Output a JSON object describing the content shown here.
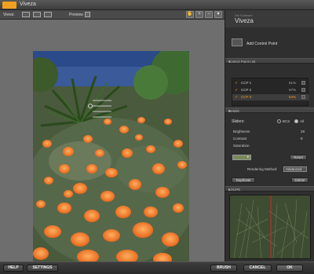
{
  "window": {
    "title": "Viveza"
  },
  "toolbar": {
    "views_label": "Views:",
    "preview_label": "Preview"
  },
  "photo": {
    "filename": "1080243.RAW",
    "info": "(7.8MP, 3072 x 2304, 300 DPI, RGB, 8 bit)"
  },
  "panel": {
    "brand_small": "Nik Software",
    "brand": "Viveza",
    "add_control_point": "Add Control Point",
    "control_point_list_header": "Control Point List",
    "control_points": [
      {
        "name": "CCP 1",
        "pct": "51%"
      },
      {
        "name": "CCP 2",
        "pct": "57%"
      },
      {
        "name": "CCP 3",
        "pct": "53%"
      }
    ],
    "details_header": "Details",
    "sliders_label": "Sliders:",
    "bcs_label": "BCS",
    "all_label": "All",
    "sliders": [
      {
        "name": "Brightness",
        "value": "29"
      },
      {
        "name": "Contrast",
        "value": "8"
      },
      {
        "name": "Saturation",
        "value": ""
      }
    ],
    "reset_label": "Reset",
    "rendering_method_label": "Rendering Method:",
    "rendering_method_value": "Advanced",
    "duplicate_label": "Duplicate",
    "delete_label": "Delete",
    "loupe_header": "LOUPE"
  },
  "bottom": {
    "help": "HELP",
    "settings": "SETTINGS",
    "brush": "BRUSH",
    "cancel": "CANCEL",
    "ok": "OK"
  }
}
